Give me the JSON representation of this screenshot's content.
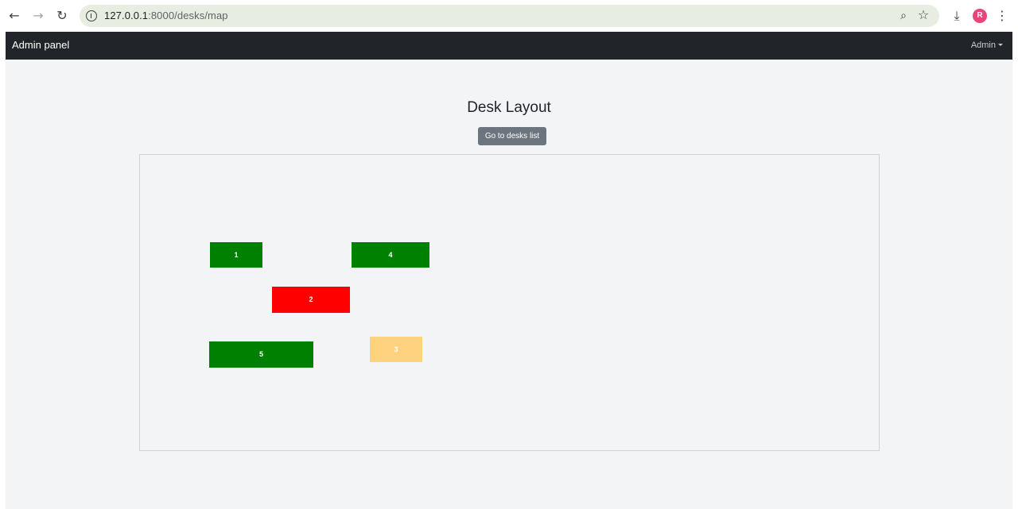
{
  "browser": {
    "url_host": "127.0.0.1",
    "url_rest": ":8000/desks/map",
    "avatar_letter": "R"
  },
  "navbar": {
    "brand": "Admin panel",
    "user_menu": "Admin"
  },
  "page": {
    "title": "Desk Layout",
    "desks_list_button": "Go to desks list"
  },
  "colors": {
    "available": "#008000",
    "occupied": "#ff0000",
    "reserved": "#ffd280"
  },
  "desks": [
    {
      "label": "1",
      "status": "available"
    },
    {
      "label": "4",
      "status": "available"
    },
    {
      "label": "2",
      "status": "occupied"
    },
    {
      "label": "5",
      "status": "available"
    },
    {
      "label": "3",
      "status": "reserved"
    }
  ]
}
